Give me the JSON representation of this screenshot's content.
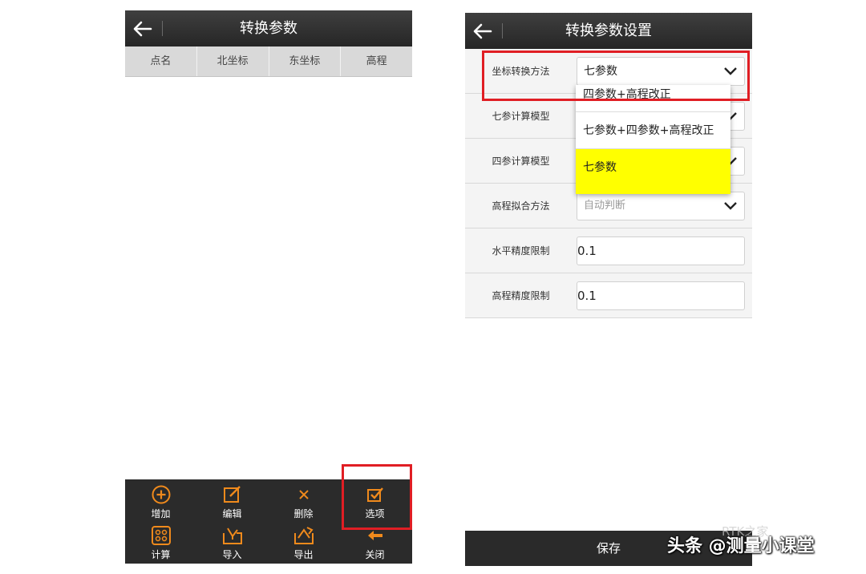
{
  "left_screen": {
    "title": "转换参数",
    "columns": [
      "点名",
      "北坐标",
      "东坐标",
      "高程"
    ],
    "toolbar": {
      "add": "增加",
      "edit": "编辑",
      "delete": "删除",
      "options": "选项",
      "calculate": "计算",
      "import": "导入",
      "export": "导出",
      "close": "关闭"
    }
  },
  "right_screen": {
    "title": "转换参数设置",
    "rows": {
      "method": {
        "label": "坐标转换方法",
        "value": "七参数"
      },
      "seven_model": {
        "label": "七参计算模型"
      },
      "four_model": {
        "label": "四参计算模型"
      },
      "height_fit": {
        "label": "高程拟合方法",
        "value": "自动判断"
      },
      "h_precision": {
        "label": "水平精度限制",
        "value": "0.1"
      },
      "v_precision": {
        "label": "高程精度限制",
        "value": "0.1"
      }
    },
    "dropdown_options": [
      "四参数+高程改正",
      "七参数+四参数+高程改正",
      "七参数"
    ],
    "save_label": "保存"
  },
  "watermark": {
    "text": "头条 @测量小课堂",
    "faint_text": "RTK之家"
  },
  "colors": {
    "titlebar": "#2f2f2f",
    "accent_orange": "#f08a1c",
    "highlight_red": "#e01e24",
    "selected_yellow": "#ffff00"
  }
}
